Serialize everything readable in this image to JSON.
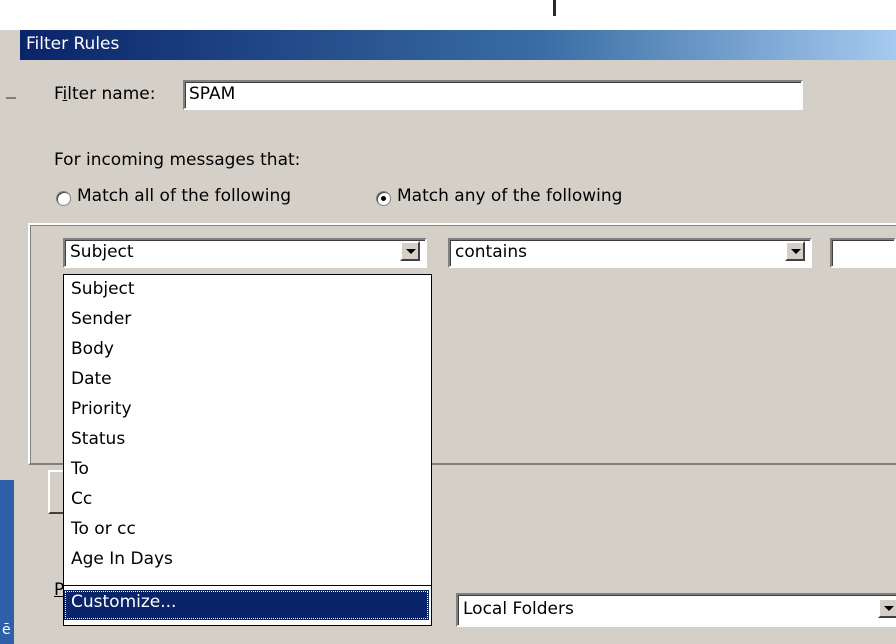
{
  "background": {
    "left_char": "ē"
  },
  "dialog": {
    "title": "Filter Rules",
    "filter_name": {
      "label_pre": "F",
      "label_accel": "i",
      "label_post": "lter name:",
      "value": "SPAM"
    },
    "incoming_label": "For incoming messages that:",
    "match_all": {
      "label": "Match all of the following",
      "selected": false
    },
    "match_any": {
      "label": "Match any of the following",
      "selected": true
    },
    "criteria": {
      "field": "Subject",
      "operator": "contains",
      "value": ""
    },
    "field_options": [
      "Subject",
      "Sender",
      "Body",
      "Date",
      "Priority",
      "Status",
      "To",
      "Cc",
      "To or cc",
      "Age In Days"
    ],
    "customize_option": "Customize...",
    "action_label_char": "P",
    "folder_value": "Local Folders"
  },
  "colors": {
    "titlebar_start": "#0a246a",
    "dialog_face": "#d4d0c8",
    "selection": "#0a246a"
  }
}
